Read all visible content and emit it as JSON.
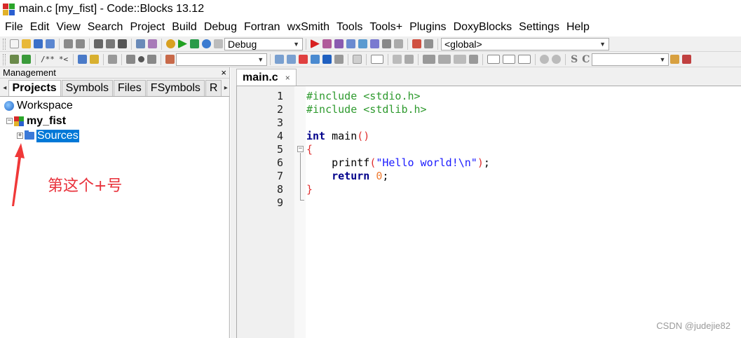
{
  "window": {
    "title": "main.c [my_fist] - Code::Blocks 13.12"
  },
  "menu": [
    "File",
    "Edit",
    "View",
    "Search",
    "Project",
    "Build",
    "Debug",
    "Fortran",
    "wxSmith",
    "Tools",
    "Tools+",
    "Plugins",
    "DoxyBlocks",
    "Settings",
    "Help"
  ],
  "toolbar": {
    "build_target": "Debug",
    "scope": "<global>",
    "doxy_comment_block": "/**",
    "doxy_comment_line": "*<",
    "symbol_s": "S",
    "symbol_c": "C"
  },
  "management": {
    "title": "Management",
    "close": "×",
    "tab_prev": "◂",
    "tab_next": "▸",
    "tabs": [
      "Projects",
      "Symbols",
      "Files",
      "FSymbols",
      "R"
    ],
    "tree": {
      "workspace": "Workspace",
      "project": "my_fist",
      "project_expander": "−",
      "folder": "Sources",
      "folder_expander": "+"
    }
  },
  "annotation": {
    "text": "第这个+号"
  },
  "editor": {
    "tab": "main.c",
    "tab_close": "×",
    "lines": [
      {
        "n": "1",
        "text": "#include <stdio.h>"
      },
      {
        "n": "2",
        "text": "#include <stdlib.h>"
      },
      {
        "n": "3",
        "text": ""
      },
      {
        "n": "4",
        "text": "int main()"
      },
      {
        "n": "5",
        "text": "{"
      },
      {
        "n": "6",
        "text": "    printf(\"Hello world!\\n\");"
      },
      {
        "n": "7",
        "text": "    return 0;"
      },
      {
        "n": "8",
        "text": "}"
      },
      {
        "n": "9",
        "text": ""
      }
    ],
    "fold_marker": "−"
  },
  "watermark": "CSDN @judejie82",
  "colors": {
    "preprocessor": "#2e9a2e",
    "keyword": "#00008b",
    "string": "#1a1aff",
    "number": "#ee7a30",
    "brace": "#e03030",
    "selection": "#0078d7",
    "annotation": "#e8303a"
  }
}
